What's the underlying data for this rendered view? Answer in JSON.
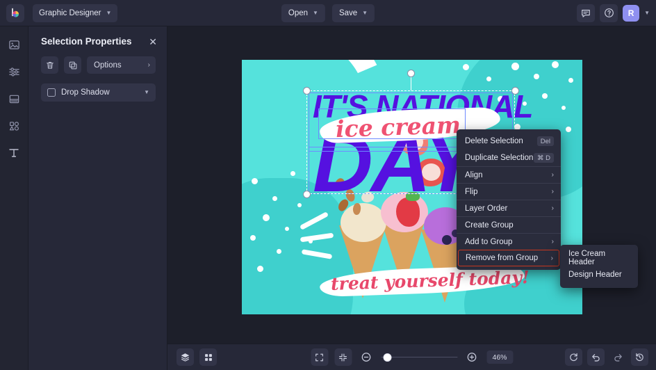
{
  "app": {
    "logo_icon": "color-wheel-logo-icon",
    "switcher_label": "Graphic Designer"
  },
  "topbar": {
    "open_label": "Open",
    "save_label": "Save",
    "comment_icon": "comment-icon",
    "help_icon": "help-circle-icon",
    "avatar_initial": "R",
    "account_chevron": "chevron-down-icon"
  },
  "rail": {
    "items": [
      {
        "icon": "image-icon",
        "name": "image"
      },
      {
        "icon": "adjustments-icon",
        "name": "adjust"
      },
      {
        "icon": "layout-icon",
        "name": "layout"
      },
      {
        "icon": "shapes-icon",
        "name": "shapes"
      },
      {
        "icon": "text-icon",
        "name": "text"
      }
    ]
  },
  "panel": {
    "title": "Selection Properties",
    "close_icon": "close-icon",
    "delete_icon": "trash-icon",
    "duplicate_icon": "duplicate-icon",
    "options_label": "Options",
    "options_arrow": "chevron-right-icon",
    "drop_shadow_label": "Drop Shadow",
    "drop_shadow_checked": false,
    "drop_shadow_chevron": "chevron-down-icon"
  },
  "canvas": {
    "background_color": "#55e2dc",
    "headline_top": "IT'S NATIONAL",
    "headline_script": "ice cream",
    "headline_big": "DAY",
    "tagline": "treat yourself today!",
    "purple": "#5511e0",
    "pink": "#ef5272"
  },
  "context_menu": {
    "items": [
      {
        "label": "Delete Selection",
        "shortcut": "Del",
        "arrow": false
      },
      {
        "label": "Duplicate Selection",
        "shortcut": "⌘ D",
        "arrow": false
      },
      {
        "label": "Align",
        "shortcut": "",
        "arrow": true
      },
      {
        "label": "Flip",
        "shortcut": "",
        "arrow": true
      },
      {
        "label": "Layer Order",
        "shortcut": "",
        "arrow": true
      },
      {
        "label": "Create Group",
        "shortcut": "",
        "arrow": false
      },
      {
        "label": "Add to Group",
        "shortcut": "",
        "arrow": true
      },
      {
        "label": "Remove from Group",
        "shortcut": "",
        "arrow": true
      }
    ],
    "highlight_color": "#c9371f",
    "highlighted_index": 7
  },
  "submenu": {
    "items": [
      {
        "label": "Ice Cream Header"
      },
      {
        "label": "Design Header"
      }
    ]
  },
  "bottombar": {
    "layers_icon": "layers-icon",
    "grid_icon": "grid-icon",
    "fit_icon": "fit-screen-icon",
    "shrink_icon": "shrink-icon",
    "zoom_out_icon": "zoom-out-icon",
    "zoom_in_icon": "zoom-in-icon",
    "zoom_value": "46%",
    "zoom_slider_percent": 3,
    "reset_icon": "refresh-icon",
    "undo_icon": "undo-icon",
    "redo_icon": "redo-icon",
    "history_icon": "history-icon"
  }
}
